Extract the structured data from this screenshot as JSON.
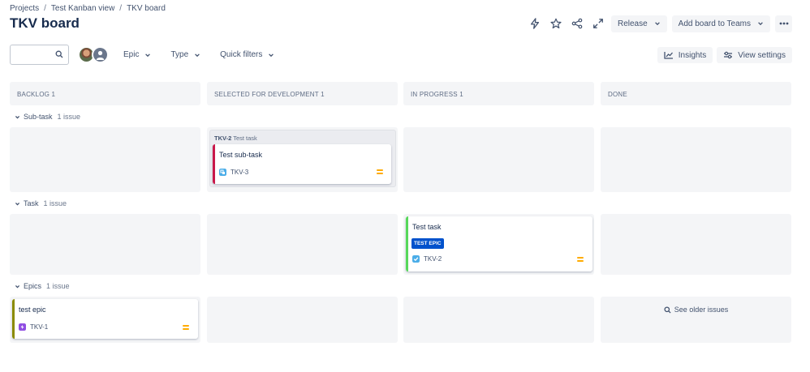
{
  "breadcrumb": [
    "Projects",
    "Test Kanban view",
    "TKV board"
  ],
  "title": "TKV board",
  "header": {
    "icons": [
      "lightning-icon",
      "star-icon",
      "share-icon",
      "expand-icon"
    ],
    "release_label": "Release",
    "add_teams_label": "Add board to Teams",
    "more_icon": "more-icon"
  },
  "toolbar": {
    "search_placeholder": "",
    "filters": [
      "Epic",
      "Type",
      "Quick filters"
    ],
    "insights_label": "Insights",
    "view_settings_label": "View settings"
  },
  "columns": [
    "BACKLOG 1",
    "SELECTED FOR DEVELOPMENT 1",
    "IN PROGRESS 1",
    "DONE"
  ],
  "swimlanes": [
    {
      "name": "Sub-task",
      "count": "1 issue"
    },
    {
      "name": "Task",
      "count": "1 issue"
    },
    {
      "name": "Epics",
      "count": "1 issue"
    }
  ],
  "cards": {
    "subtask": {
      "parent_key": "TKV-2",
      "parent_title": "Test task",
      "title": "Test sub-task",
      "key": "TKV-3",
      "type_icon": "subtask-icon",
      "bar_color": "#c9184a",
      "icon_color": "#4bade8"
    },
    "task": {
      "title": "Test task",
      "epic": "TEST EPIC",
      "key": "TKV-2",
      "type_icon": "task-icon",
      "bar_color": "#57d85a",
      "icon_color": "#4bade8"
    },
    "epic": {
      "title": "test epic",
      "key": "TKV-1",
      "type_icon": "epic-icon",
      "bar_color": "#8b8b00",
      "icon_color": "#904ee2"
    }
  },
  "see_older_label": "See older issues",
  "colors": {
    "accent": "#0052cc",
    "priority": "#ffab00"
  }
}
